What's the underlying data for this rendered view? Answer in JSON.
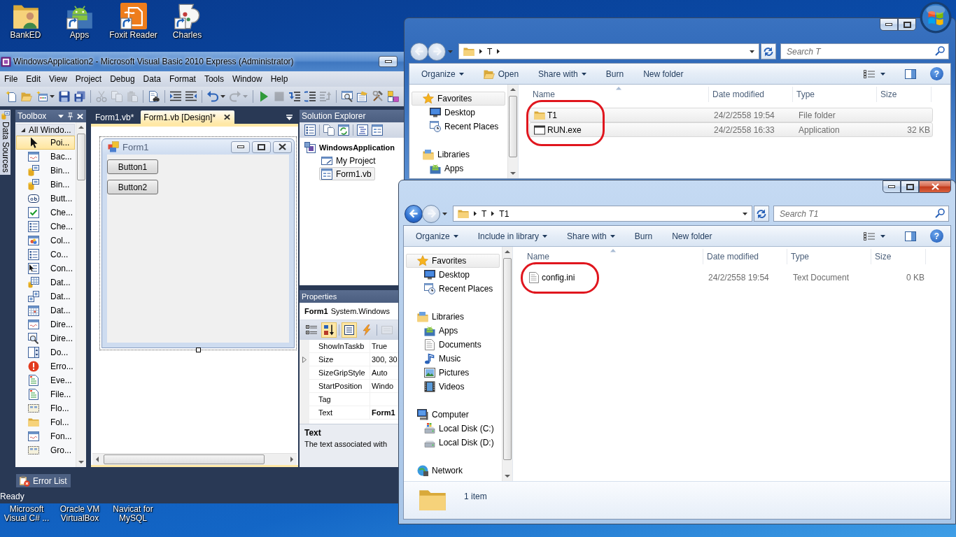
{
  "desktop": {
    "top_icons": [
      {
        "label": "BankED",
        "shortcut": false
      },
      {
        "label": "Apps",
        "shortcut": true
      },
      {
        "label": "Foxit Reader",
        "shortcut": true
      },
      {
        "label": "Charles",
        "shortcut": true
      }
    ],
    "bottom_icons": [
      {
        "lines": [
          "Microsoft",
          "Visual C# ..."
        ]
      },
      {
        "lines": [
          "Oracle VM",
          "VirtualBox"
        ]
      },
      {
        "lines": [
          "Navicat for",
          "MySQL"
        ]
      }
    ]
  },
  "ide": {
    "title": "WindowsApplication2 - Microsoft Visual Basic 2010 Express (Administrator)",
    "menu": [
      "File",
      "Edit",
      "View",
      "Project",
      "Debug",
      "Data",
      "Format",
      "Tools",
      "Window",
      "Help"
    ],
    "toolbar": [
      [
        {
          "disabled": false,
          "dropdown": false
        },
        {
          "disabled": false,
          "dropdown": false
        },
        {
          "disabled": false,
          "dropdown": true
        },
        {
          "disabled": false,
          "dropdown": false
        },
        {
          "disabled": false,
          "dropdown": false
        }
      ],
      [
        {
          "disabled": true,
          "dropdown": false
        },
        {
          "disabled": true,
          "dropdown": false
        },
        {
          "disabled": true,
          "dropdown": false
        }
      ],
      [
        {
          "disabled": false,
          "dropdown": false
        }
      ],
      [
        {
          "disabled": false,
          "dropdown": false
        },
        {
          "disabled": false,
          "dropdown": false
        }
      ],
      [
        {
          "disabled": false,
          "dropdown": true
        },
        {
          "disabled": true,
          "dropdown": true
        }
      ],
      [
        {
          "disabled": false,
          "dropdown": false
        },
        {
          "disabled": true,
          "dropdown": false
        },
        {
          "disabled": false,
          "dropdown": false
        },
        {
          "disabled": false,
          "dropdown": false
        },
        {
          "disabled": true,
          "dropdown": false
        }
      ],
      [
        {
          "disabled": false,
          "dropdown": false
        },
        {
          "disabled": false,
          "dropdown": false
        },
        {
          "disabled": false,
          "dropdown": false
        },
        {
          "disabled": false,
          "dropdown": false
        }
      ]
    ],
    "side_tab": "Data Sources",
    "toolbox": {
      "title": "Toolbox",
      "group": {
        "label": "All Windo...",
        "expanded": true
      },
      "items": [
        {
          "label": "Poi...",
          "selected": true
        },
        {
          "label": "Bac...",
          "selected": false
        },
        {
          "label": "Bin...",
          "selected": false
        },
        {
          "label": "Bin...",
          "selected": false
        },
        {
          "label": "Butt...",
          "selected": false
        },
        {
          "label": "Che...",
          "selected": false
        },
        {
          "label": "Che...",
          "selected": false
        },
        {
          "label": "Col...",
          "selected": false
        },
        {
          "label": "Co...",
          "selected": false
        },
        {
          "label": "Con...",
          "selected": false
        },
        {
          "label": "Dat...",
          "selected": false
        },
        {
          "label": "Dat...",
          "selected": false
        },
        {
          "label": "Dat...",
          "selected": false
        },
        {
          "label": "Dire...",
          "selected": false
        },
        {
          "label": "Dire...",
          "selected": false
        },
        {
          "label": "Do...",
          "selected": false
        },
        {
          "label": "Erro...",
          "selected": false
        },
        {
          "label": "Eve...",
          "selected": false
        },
        {
          "label": "File...",
          "selected": false
        },
        {
          "label": "Flo...",
          "selected": false
        },
        {
          "label": "Fol...",
          "selected": false
        },
        {
          "label": "Fon...",
          "selected": false
        },
        {
          "label": "Gro...",
          "selected": false
        }
      ]
    },
    "document_tabs": [
      {
        "label": "Form1.vb*",
        "selected": false
      },
      {
        "label": "Form1.vb [Design]*",
        "selected": true
      }
    ],
    "form": {
      "title": "Form1",
      "buttons": [
        "Button1",
        "Button2"
      ]
    },
    "solution_explorer": {
      "title": "Solution Explorer",
      "tree": [
        {
          "label": "WindowsApplication",
          "selected": false,
          "children": [
            {
              "label": "My Project",
              "selected": false
            },
            {
              "label": "Form1.vb",
              "selected": true
            }
          ]
        }
      ]
    },
    "properties": {
      "title": "Properties",
      "object": "**Form1** System.Windows",
      "tools": [
        {
          "selected": false,
          "disabled": false
        },
        {
          "selected": true,
          "disabled": false
        },
        {
          "selected": true,
          "disabled": false
        },
        {
          "selected": false,
          "disabled": false
        },
        {
          "selected": false,
          "disabled": true
        }
      ],
      "rows": [
        {
          "name": "ShowInTaskb",
          "value": "True",
          "expandable": false,
          "modified": false
        },
        {
          "name": "Size",
          "value": "300, 30",
          "expandable": true,
          "modified": false
        },
        {
          "name": "SizeGripStyle",
          "value": "Auto",
          "expandable": false,
          "modified": false
        },
        {
          "name": "StartPosition",
          "value": "Windo",
          "expandable": false,
          "modified": false
        },
        {
          "name": "Tag",
          "expandable": false
        },
        {
          "name": "Text",
          "value": "Form1",
          "expandable": false,
          "modified": true
        }
      ],
      "description_title": "Text",
      "description": "The text associated with"
    },
    "error_list_tab": "Error List",
    "status": "Ready"
  },
  "explorer_windows": [
    {
      "active": false,
      "caption_buttons": [
        {
          "kind": "minimize"
        },
        {
          "kind": "maximize"
        }
      ],
      "back_enabled": false,
      "path": [
        {
          "label": "T",
          "arrow": true
        }
      ],
      "search_placeholder": "Search T",
      "commands": [
        {
          "label": "Organize",
          "kind": "menu"
        },
        {
          "label": "Open",
          "kind": "icon"
        },
        {
          "label": "Share with",
          "kind": "menu"
        },
        {
          "label": "Burn",
          "kind": "plain"
        },
        {
          "label": "New folder",
          "kind": "plain"
        }
      ],
      "help": "?",
      "navigation": [
        {
          "label": "Favorites",
          "kind": "favorites",
          "selected": true,
          "children": [
            {
              "label": "Desktop",
              "kind": "desktop",
              "selected": false
            },
            {
              "label": "Recent Places",
              "kind": "recent",
              "selected": false
            }
          ]
        },
        {
          "label": "Libraries",
          "kind": "libraries",
          "selected": false,
          "children": [
            {
              "label": "Apps",
              "kind": "apps",
              "selected": false
            }
          ]
        }
      ],
      "columns": [
        {
          "label": "Name",
          "sorted": true
        },
        {
          "label": "Date modified",
          "sorted": false
        },
        {
          "label": "Type",
          "sorted": false
        },
        {
          "label": "Size",
          "sorted": false
        }
      ],
      "files": [
        {
          "name": "T1",
          "kind": "folder",
          "date_modified": "24/2/2558 19:54",
          "type": "File folder",
          "selected": true
        },
        {
          "name": "RUN.exe",
          "kind": "application",
          "date_modified": "24/2/2558 16:33",
          "type": "Application",
          "size": "32 KB",
          "selected": true
        }
      ],
      "names_circled": true
    },
    {
      "active": true,
      "caption_buttons": [
        {
          "kind": "minimize"
        },
        {
          "kind": "maximize"
        },
        {
          "kind": "close"
        }
      ],
      "back_enabled": true,
      "path": [
        {
          "label": "T",
          "arrow": true
        },
        {
          "label": "T1",
          "arrow": false
        }
      ],
      "search_placeholder": "Search T1",
      "commands": [
        {
          "label": "Organize",
          "kind": "menu"
        },
        {
          "label": "Include in library",
          "kind": "menu"
        },
        {
          "label": "Share with",
          "kind": "menu"
        },
        {
          "label": "Burn",
          "kind": "plain"
        },
        {
          "label": "New folder",
          "kind": "plain"
        }
      ],
      "help": "?",
      "navigation": [
        {
          "label": "Favorites",
          "kind": "favorites",
          "selected": true,
          "children": [
            {
              "label": "Desktop",
              "kind": "desktop",
              "selected": false
            },
            {
              "label": "Recent Places",
              "kind": "recent",
              "selected": false
            }
          ]
        },
        {
          "label": "Libraries",
          "kind": "libraries",
          "selected": false,
          "children": [
            {
              "label": "Apps",
              "kind": "apps",
              "selected": false
            },
            {
              "label": "Documents",
              "kind": "documents",
              "selected": false
            },
            {
              "label": "Music",
              "kind": "music",
              "selected": false
            },
            {
              "label": "Pictures",
              "kind": "pictures",
              "selected": false
            },
            {
              "label": "Videos",
              "kind": "videos",
              "selected": false
            }
          ]
        },
        {
          "label": "Computer",
          "kind": "computer",
          "selected": false,
          "children": [
            {
              "label": "Local Disk (C:)",
              "kind": "system_disk",
              "selected": false
            },
            {
              "label": "Local Disk (D:)",
              "kind": "disk",
              "selected": false
            }
          ]
        },
        {
          "label": "Network",
          "kind": "network",
          "selected": false
        }
      ],
      "columns": [
        {
          "label": "Name",
          "sorted": true
        },
        {
          "label": "Date modified",
          "sorted": false
        },
        {
          "label": "Type",
          "sorted": false
        },
        {
          "label": "Size",
          "sorted": false
        }
      ],
      "files": [
        {
          "name": "config.ini",
          "kind": "text",
          "date_modified": "24/2/2558 19:54",
          "type": "Text Document",
          "size": "0 KB",
          "selected": false
        }
      ],
      "names_circled": true,
      "details": {
        "count": "1 item"
      }
    }
  ]
}
